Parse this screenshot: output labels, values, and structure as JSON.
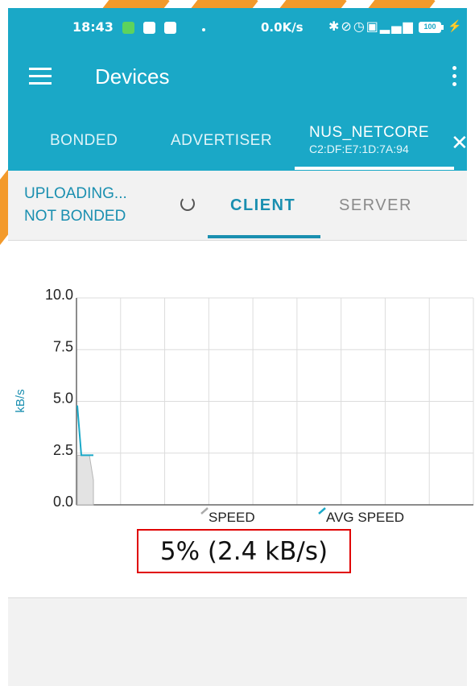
{
  "status_bar": {
    "time": "18:43",
    "network_speed": "0.0K/s",
    "icons": [
      "bluetooth-icon",
      "mute-icon",
      "alarm-icon",
      "hd-icon",
      "4g-signal-icon"
    ],
    "battery_level": "100"
  },
  "app_bar": {
    "title": "Devices"
  },
  "tabs": {
    "bonded": "BONDED",
    "advertiser": "ADVERTISER",
    "active_name": "NUS_NETCORE",
    "active_address": "C2:DF:E7:1D:7A:94"
  },
  "connection": {
    "status_line1": "UPLOADING...",
    "status_line2": "NOT BONDED",
    "client_tab": "CLIENT",
    "server_tab": "SERVER"
  },
  "chart_data": {
    "type": "line",
    "ylabel": "kB/s",
    "ylim": [
      0.0,
      10.0
    ],
    "yticks": [
      "10.0",
      "7.5",
      "5.0",
      "2.5",
      "0.0"
    ],
    "grid": true,
    "legend_position": "bottom",
    "series": [
      {
        "name": "SPEED",
        "color": "#cfcfcf",
        "values": [
          2.4,
          2.4,
          2.4,
          2.4,
          1.2
        ]
      },
      {
        "name": "AVG SPEED",
        "color": "#1aa8c7",
        "values": [
          4.8,
          2.4,
          2.4,
          2.4,
          2.4
        ]
      }
    ]
  },
  "progress": {
    "text": "5% (2.4 kB/s)"
  },
  "colors": {
    "primary": "#1aa8c7",
    "accent_text": "#1a8fb0",
    "highlight_box": "#e00000"
  }
}
